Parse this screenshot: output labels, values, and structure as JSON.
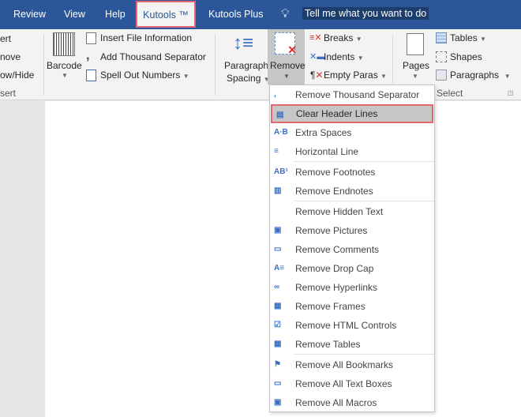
{
  "tabs": [
    "Review",
    "View",
    "Help",
    "Kutools ™",
    "Kutools Plus"
  ],
  "tell_me": "Tell me what you want to do",
  "ribbon": {
    "partial_left": [
      "ert",
      "nove",
      "ow/Hide",
      "sert"
    ],
    "barcode": "Barcode",
    "insert_file_info": "Insert File Information",
    "add_thousand_sep": "Add Thousand Separator",
    "spell_out_numbers": "Spell Out Numbers",
    "paragraph_spacing": [
      "Paragraph",
      "Spacing"
    ],
    "remove": "Remove",
    "breaks": "Breaks",
    "indents": "Indents",
    "empty_paras": "Empty Paras",
    "pages": "Pages",
    "tables": "Tables",
    "shapes": "Shapes",
    "paragraphs": "Paragraphs",
    "select_group": "Select"
  },
  "menu": [
    {
      "label": "Remove Thousand Separator",
      "icon": "thousand-separator-icon"
    },
    {
      "label": "Clear Header Lines",
      "icon": "header-lines-icon",
      "highlighted": true
    },
    {
      "label": "Extra Spaces",
      "icon": "extra-spaces-icon"
    },
    {
      "label": "Horizontal Line",
      "icon": "horizontal-line-icon"
    },
    {
      "label": "Remove Footnotes",
      "icon": "footnotes-icon"
    },
    {
      "label": "Remove Endnotes",
      "icon": "endnotes-icon"
    },
    {
      "label": "Remove Hidden Text",
      "icon": ""
    },
    {
      "label": "Remove Pictures",
      "icon": "pictures-icon"
    },
    {
      "label": "Remove Comments",
      "icon": "comments-icon"
    },
    {
      "label": "Remove Drop Cap",
      "icon": "drop-cap-icon"
    },
    {
      "label": "Remove Hyperlinks",
      "icon": "hyperlinks-icon"
    },
    {
      "label": "Remove Frames",
      "icon": "frames-icon"
    },
    {
      "label": "Remove HTML Controls",
      "icon": "html-controls-icon"
    },
    {
      "label": "Remove Tables",
      "icon": "tables-icon"
    },
    {
      "label": "Remove All Bookmarks",
      "icon": "bookmarks-icon"
    },
    {
      "label": "Remove All Text Boxes",
      "icon": "text-boxes-icon"
    },
    {
      "label": "Remove All Macros",
      "icon": "macros-icon"
    }
  ]
}
